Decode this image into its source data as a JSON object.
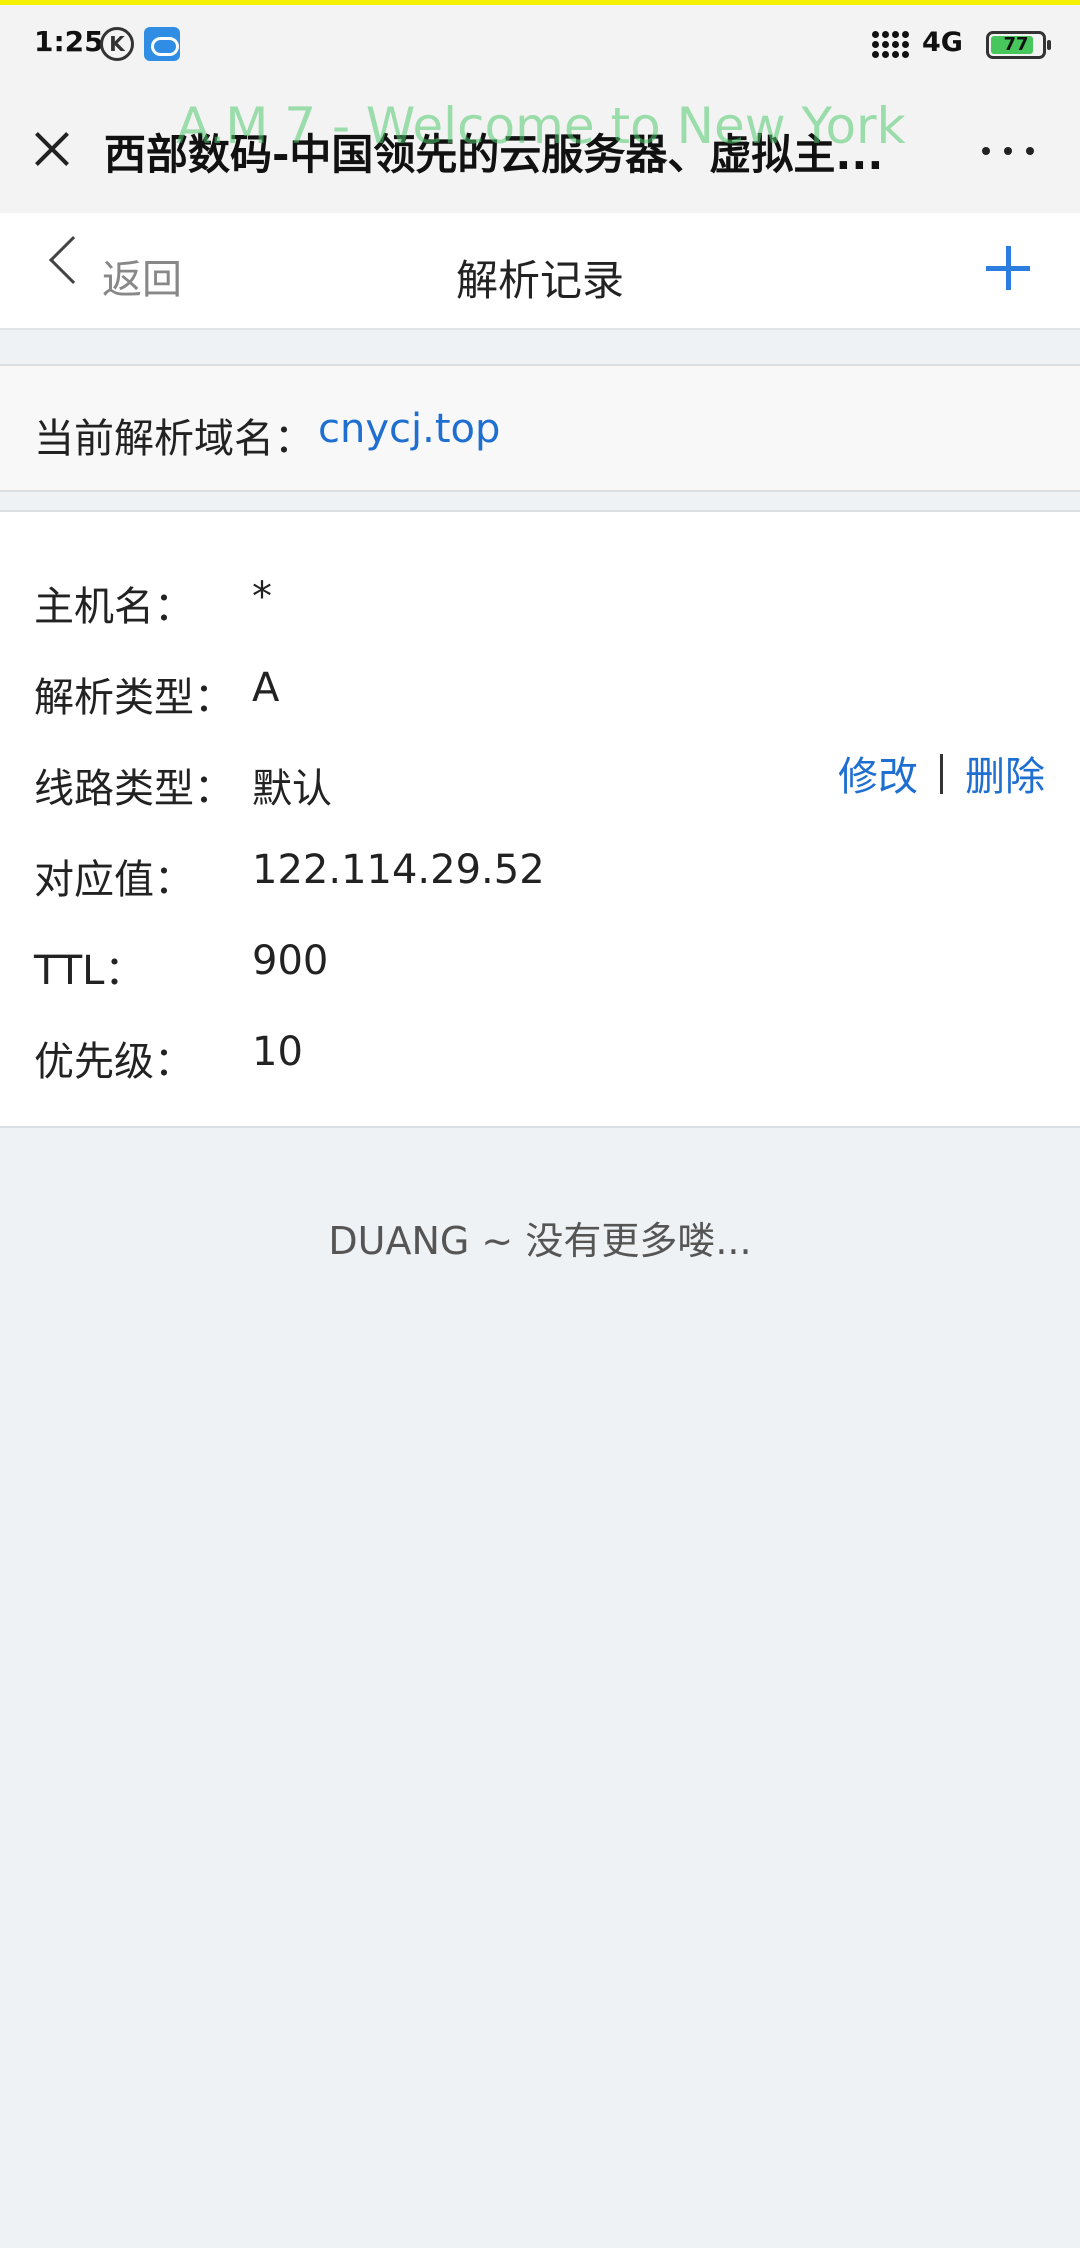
{
  "status_bar": {
    "time": "1:25",
    "k_icon": "K",
    "network": "4G",
    "battery": "77"
  },
  "browser": {
    "title": "西部数码-中国领先的云服务器、虚拟主...",
    "watermark": "A.M 7 - Welcome to New York"
  },
  "nav": {
    "back_label": "返回",
    "title": "解析记录"
  },
  "domain": {
    "label": "当前解析域名：",
    "value": "cnycj.top"
  },
  "record": {
    "rows": [
      {
        "label": "主机名：",
        "value": "*"
      },
      {
        "label": "解析类型：",
        "value": "A"
      },
      {
        "label": "线路类型：",
        "value": "默认"
      },
      {
        "label": "对应值：",
        "value": "122.114.29.52"
      },
      {
        "label": "TTL：",
        "value": "900"
      },
      {
        "label": "优先级：",
        "value": "10"
      }
    ],
    "edit_label": "修改",
    "delete_label": "删除"
  },
  "footer": {
    "message": "DUANG ~ 没有更多喽..."
  },
  "colors": {
    "link": "#1f6fd1",
    "accent": "#2b7de0",
    "background": "#eff2f4"
  }
}
